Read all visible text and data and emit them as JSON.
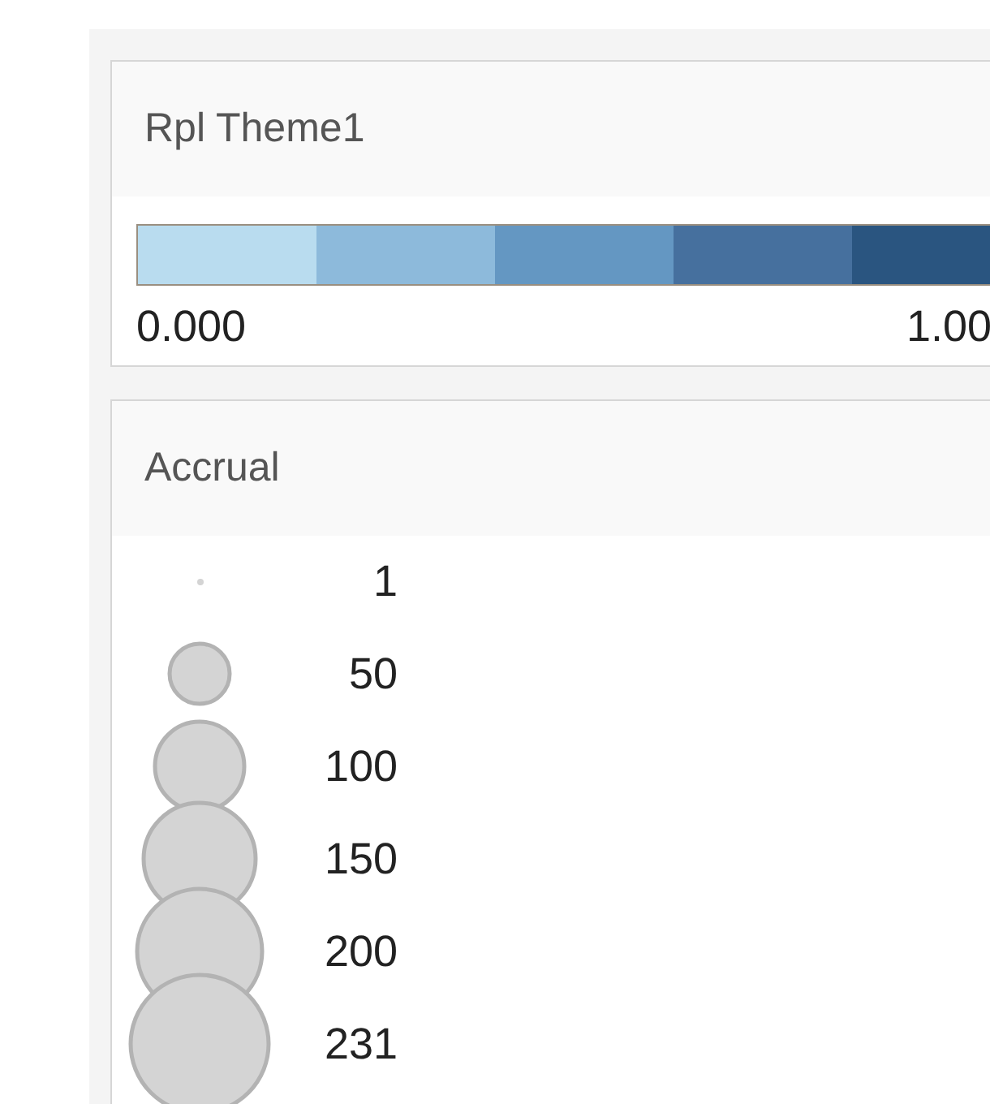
{
  "color_legend": {
    "title": "Rpl Theme1",
    "steps": [
      {
        "color": "#b9dcef"
      },
      {
        "color": "#8dbadb"
      },
      {
        "color": "#6497c2"
      },
      {
        "color": "#46709e"
      },
      {
        "color": "#2a5580"
      }
    ],
    "min_label": "0.000",
    "max_label": "1.00"
  },
  "size_legend": {
    "title": "Accrual",
    "items": [
      {
        "label": "1"
      },
      {
        "label": "50"
      },
      {
        "label": "100"
      },
      {
        "label": "150"
      },
      {
        "label": "200"
      },
      {
        "label": "231"
      }
    ]
  }
}
